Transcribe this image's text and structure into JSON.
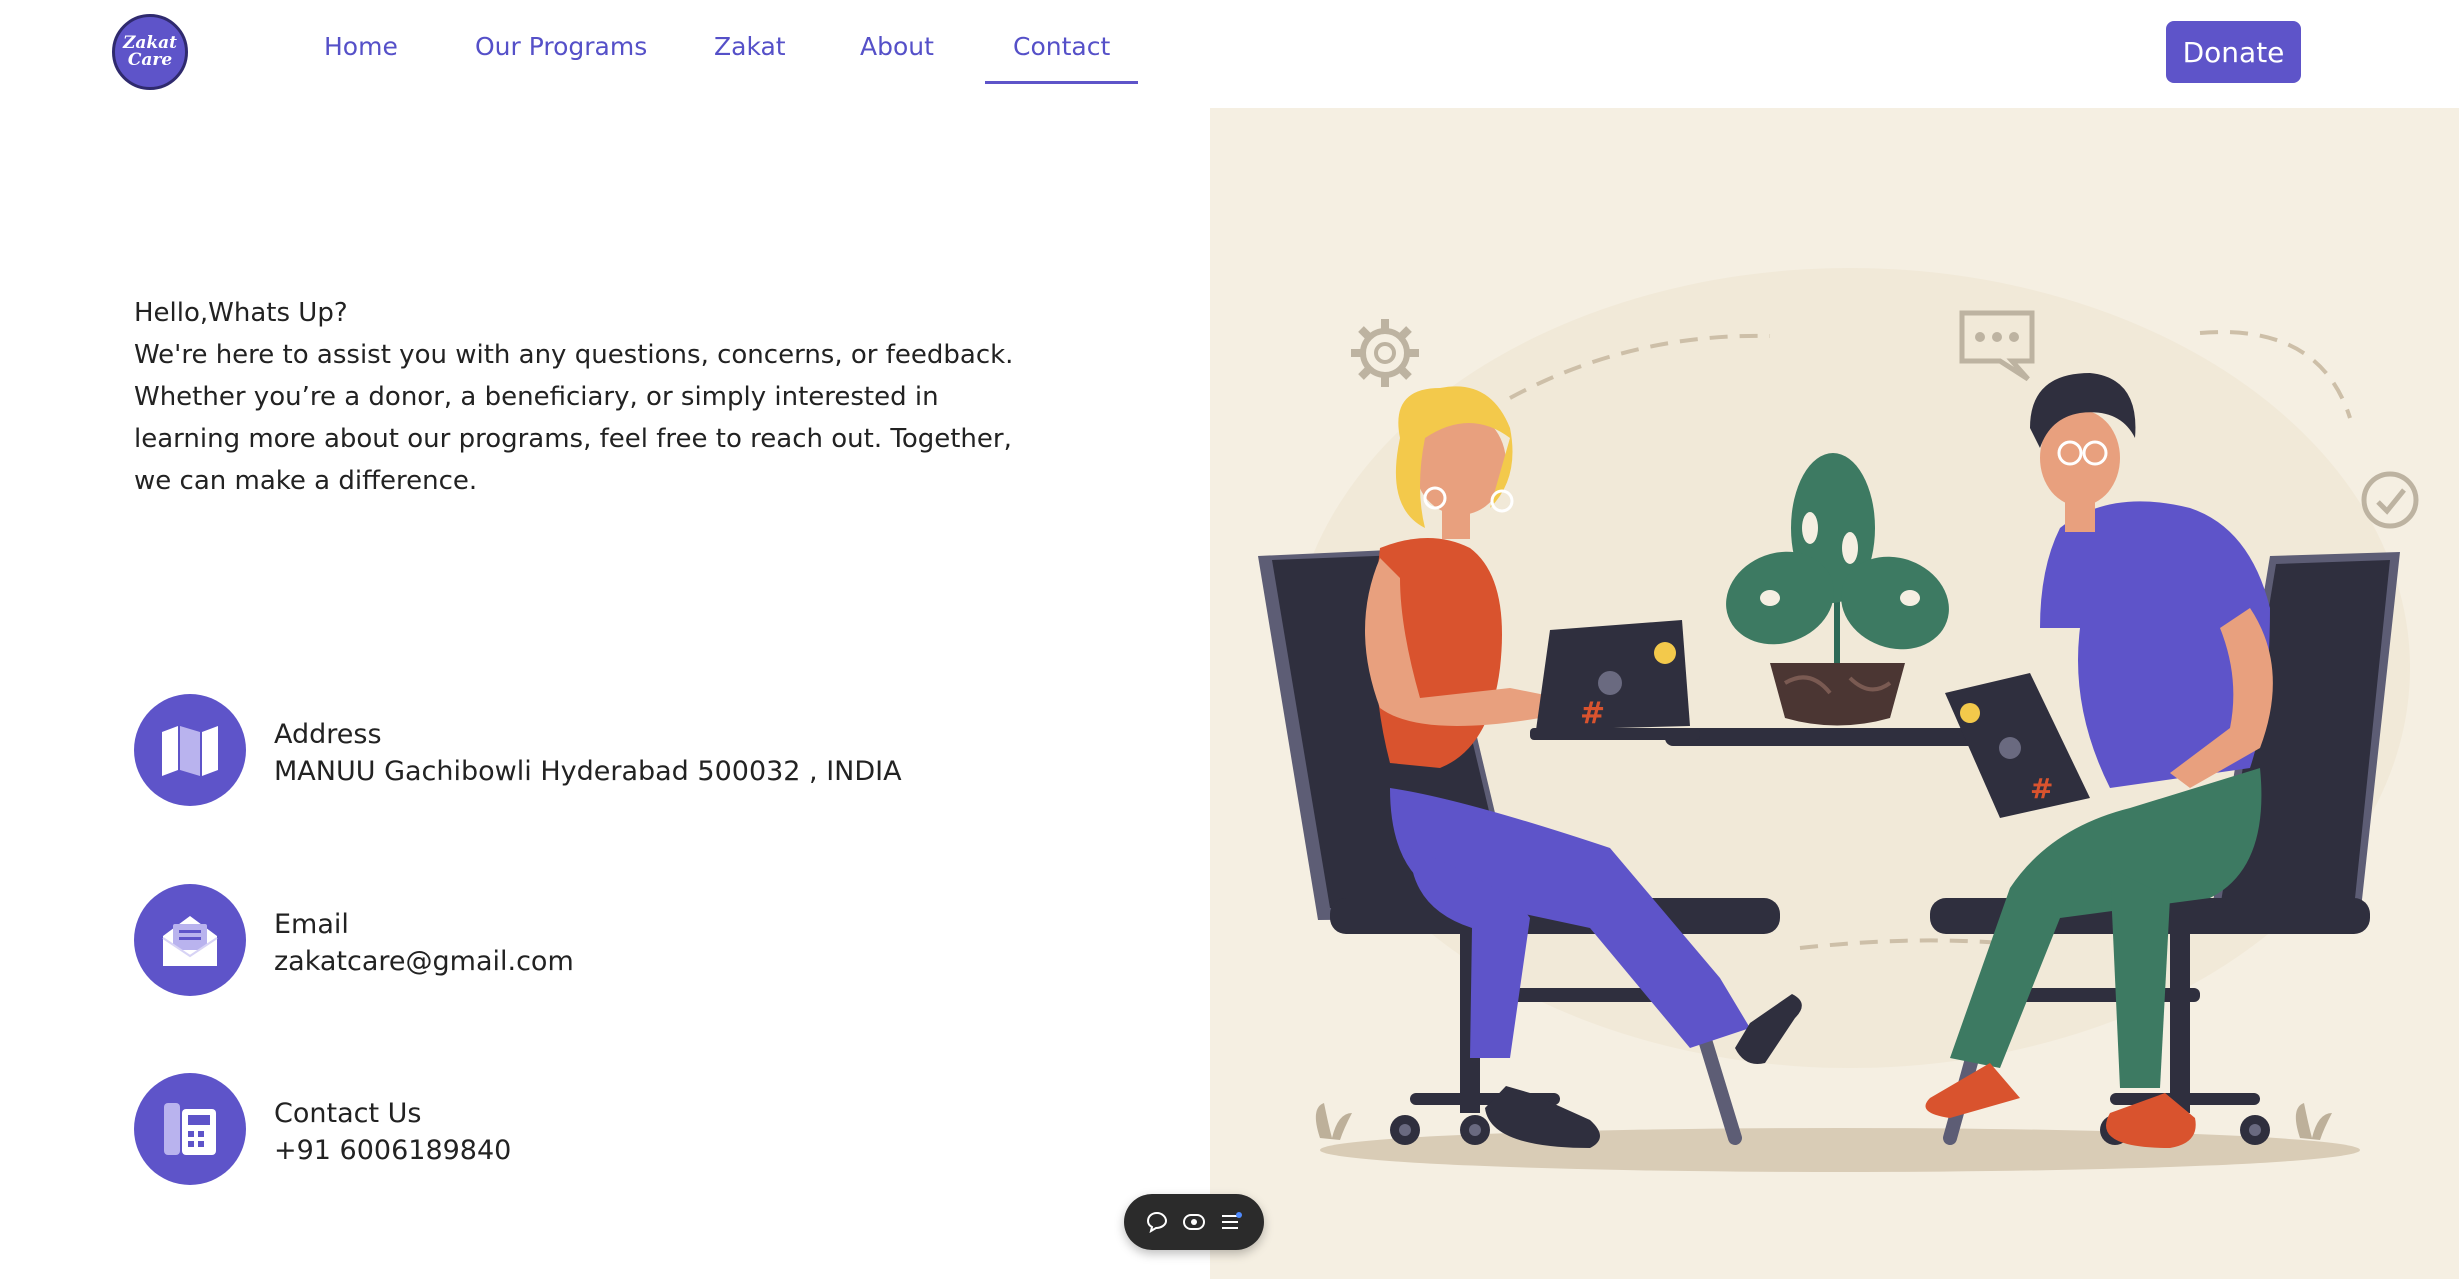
{
  "brand": {
    "logo_line1": "Zakat",
    "logo_line2": "Care"
  },
  "nav": {
    "items": [
      {
        "label": "Home"
      },
      {
        "label": "Our Programs"
      },
      {
        "label": "Zakat"
      },
      {
        "label": "About"
      },
      {
        "label": "Contact",
        "active": true
      }
    ],
    "donate_label": "Donate"
  },
  "intro": {
    "greeting": "Hello,Whats Up?",
    "body": "We're here to assist you with any questions, concerns, or feedback. Whether you’re a donor, a beneficiary, or simply interested in learning more about our programs, feel free to reach out. Together, we can make a difference."
  },
  "contacts": [
    {
      "title": "Address",
      "value": "MANUU Gachibowli Hyderabad 500032 , INDIA",
      "icon": "map-icon"
    },
    {
      "title": "Email",
      "value": "zakatcare@gmail.com",
      "icon": "mail-icon"
    },
    {
      "title": "Contact Us",
      "value": "+91 6006189840",
      "icon": "phone-icon"
    }
  ],
  "floating_toolbar": {
    "icons": [
      "comment-icon",
      "eye-icon",
      "menu-icon"
    ]
  },
  "colors": {
    "accent": "#5e54c9",
    "nav_text": "#5550c8",
    "illustration_bg": "#f5efe2"
  }
}
